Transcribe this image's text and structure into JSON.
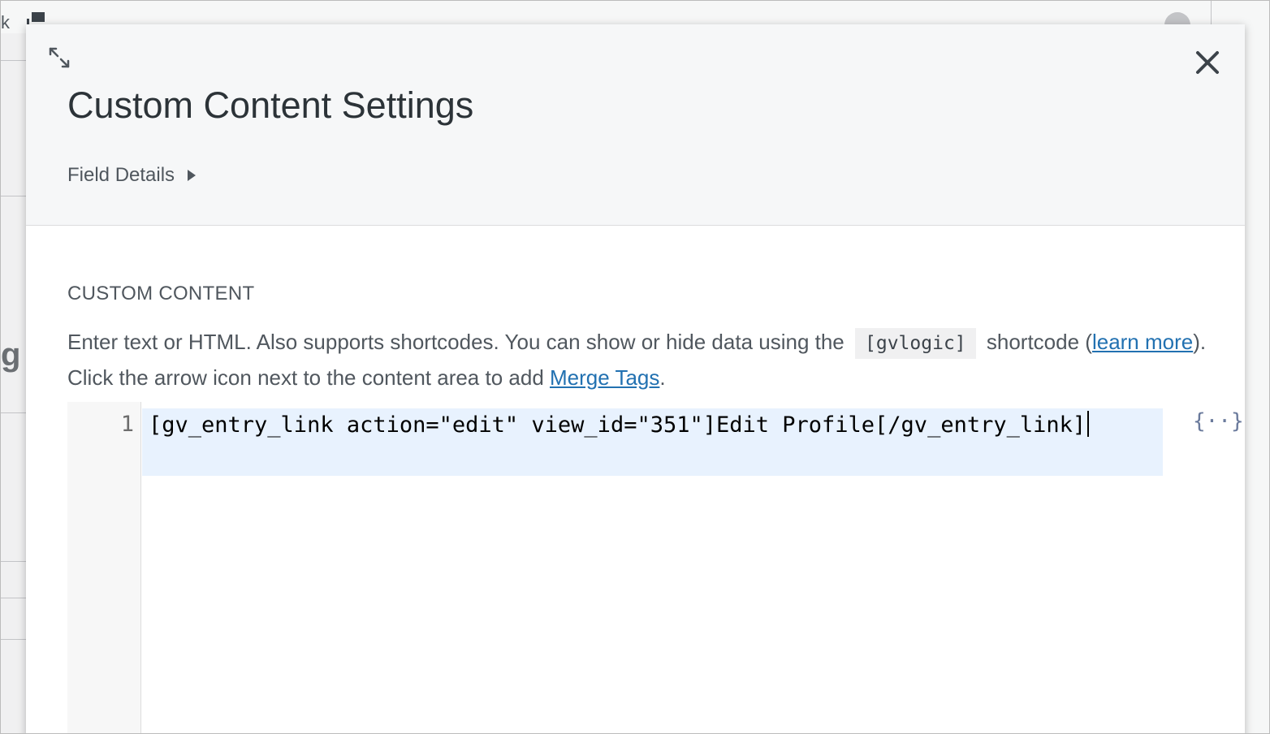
{
  "modal": {
    "title": "Custom Content Settings",
    "field_details_label": "Field Details",
    "section_label": "CUSTOM CONTENT",
    "description": {
      "part1": "Enter text or HTML. Also supports shortcodes. You can show or hide data using the",
      "code": "[gvlogic]",
      "part2": "shortcode (",
      "learn_more": "learn more",
      "part3": "). Click the arrow icon next to the content area to add",
      "merge_tags": "Merge Tags",
      "part4": "."
    },
    "editor": {
      "line_number": "1",
      "content": "[gv_entry_link action=\"edit\" view_id=\"351\"]Edit Profile[/gv_entry_link]"
    },
    "merge_tag_icon": "{··}"
  },
  "background": {
    "left_letter": "k",
    "left_fragment": "g"
  },
  "icons": {
    "expand": "expand-arrows-icon",
    "close": "close-icon",
    "disclosure": "triangle-right-icon",
    "merge_tags": "curly-braces-icon"
  },
  "colors": {
    "link": "#2271b1",
    "header_bg": "#f6f7f8",
    "active_line": "#e8f2fe",
    "text": "#50575e"
  }
}
